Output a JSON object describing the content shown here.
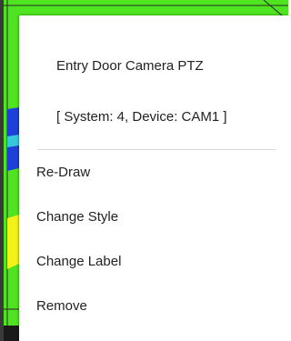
{
  "context_menu": {
    "title": "Entry Door Camera PTZ",
    "subtitle": "[ System: 4, Device: CAM1 ]",
    "items": [
      {
        "label": "Re-Draw"
      },
      {
        "label": "Change Style"
      },
      {
        "label": "Change Label"
      },
      {
        "label": "Remove"
      }
    ]
  },
  "colors": {
    "map_green": "#4ee41f",
    "map_blue": "#1f3fd9",
    "map_yellow": "#f2f21a",
    "map_border": "#1e1e1e",
    "menu_bg": "#ffffff",
    "text": "#222222",
    "divider": "#d8d8d8"
  }
}
